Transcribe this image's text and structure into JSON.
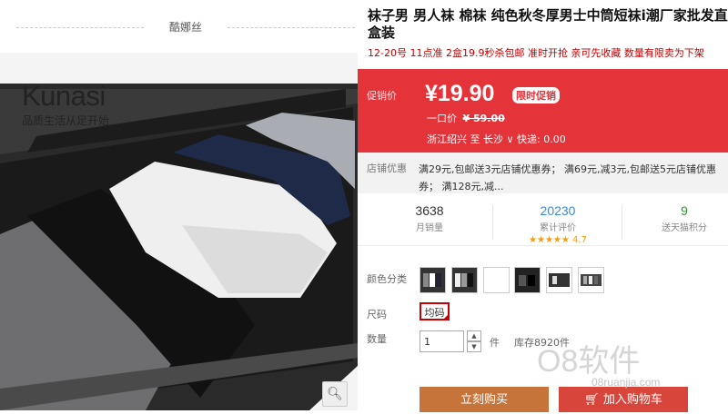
{
  "store": {
    "name": "酷娜丝"
  },
  "product_image": {
    "brand": "Kunasi",
    "slogan": "品质生活从足开始",
    "box_text": "Kunasi"
  },
  "product": {
    "title": "袜子男 男人袜 棉袜 纯色秋冬厚男士中筒短袜i潮厂家批发直盒装",
    "subtitle": "12-20号 11点准 2盒19.9秒杀包邮 准时开抢 亲可先收藏 数量有限卖为下架"
  },
  "promo": {
    "label": "促销价",
    "price": "¥19.90",
    "badge": "限时促销",
    "original_label": "一口价",
    "original_price": "¥ 59.00",
    "shipping": "浙江绍兴 至  长沙 ∨  快递: 0.00"
  },
  "coupons": {
    "label": "店铺优惠",
    "text": "满29元,包邮送3元店铺优惠券；  满69元,减3元,包邮送5元店铺优惠券；  满128元,减..."
  },
  "stats": [
    {
      "number": "3638",
      "label": "月销量"
    },
    {
      "number": "20230",
      "label": "累计评价",
      "stars": "★★★★★",
      "rating": "4.7"
    },
    {
      "number": "9",
      "label": "送天猫积分"
    }
  ],
  "options": {
    "color_label": "颜色分类",
    "size_label": "尺码",
    "size_value": "均码",
    "qty_label": "数量",
    "qty_value": "1",
    "qty_unit": "件",
    "stock": "库存8920件"
  },
  "buttons": {
    "buy": "立刻购买",
    "cart": "加入购物车"
  },
  "watermark": {
    "main": "O8软件",
    "url": "08ruanjia.com"
  },
  "colors": {
    "promo_bg": "#e5333a",
    "buy": "#c7743a",
    "cart": "#d8453a"
  }
}
